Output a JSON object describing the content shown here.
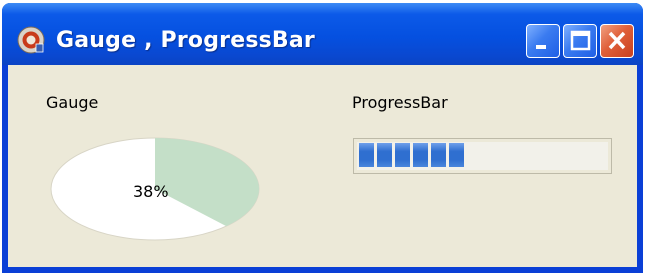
{
  "window": {
    "title": "Gauge , ProgressBar",
    "controls": [
      "minimize",
      "maximize",
      "close"
    ],
    "colors": {
      "titlebar": "#0550e0",
      "client_bg": "#ece9d8",
      "close_button": "#e0603a"
    }
  },
  "gauge": {
    "label": "Gauge",
    "value_text": "38%",
    "value": 0.38,
    "fill_color": "#c4dfc8",
    "bg_color": "#ffffff"
  },
  "progressbar": {
    "label": "ProgressBar",
    "value": 0.5,
    "visible_blocks": 6,
    "block_color": "#2f6fd0"
  },
  "icons": [
    "app-icon",
    "minimize-icon",
    "maximize-icon",
    "close-icon"
  ]
}
